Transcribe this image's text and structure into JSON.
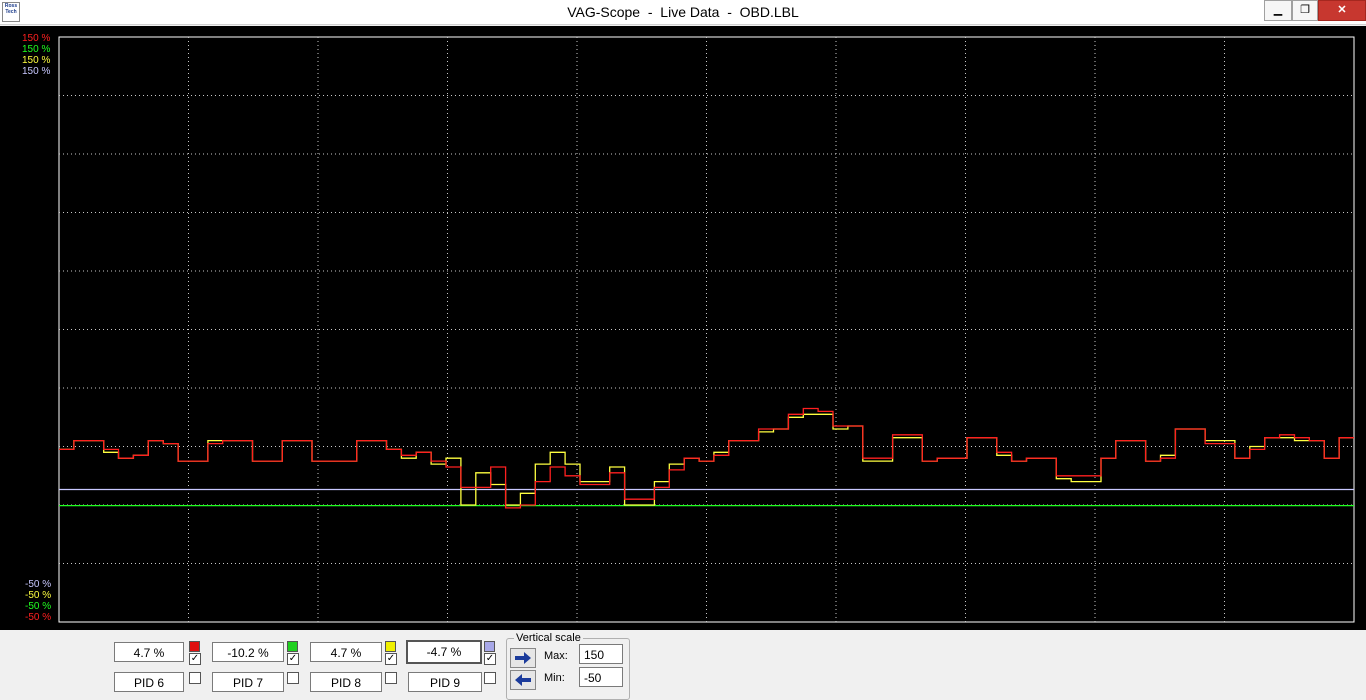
{
  "window": {
    "title": "VAG-Scope  -  Live Data  -  OBD.LBL",
    "icon_text": "Ross Tech",
    "controls": {
      "minimize": "▁",
      "maximize": "❐",
      "close": "✕"
    }
  },
  "scale_labels": {
    "top": [
      {
        "text": "150 %",
        "color": "#ff2020"
      },
      {
        "text": "150 %",
        "color": "#20ff20"
      },
      {
        "text": "150 %",
        "color": "#ffff40"
      },
      {
        "text": "150 %",
        "color": "#c8c8ff"
      }
    ],
    "bottom": [
      {
        "text": "-50 %",
        "color": "#c8c8ff"
      },
      {
        "text": "-50 %",
        "color": "#ffff40"
      },
      {
        "text": "-50 %",
        "color": "#20ff20"
      },
      {
        "text": "-50 %",
        "color": "#ff2020"
      }
    ]
  },
  "chart_data": {
    "type": "line",
    "ylim": [
      -50,
      150
    ],
    "series": [
      {
        "name": "PID 6",
        "color": "#ff2020",
        "values": [
          9,
          12,
          12,
          9,
          6,
          7,
          12,
          11,
          5,
          5,
          11,
          12,
          12,
          5,
          5,
          12,
          12,
          5,
          5,
          5,
          12,
          12,
          9,
          7,
          8,
          5,
          3,
          -4,
          -4,
          3,
          -11,
          -10,
          -2,
          3,
          0,
          -3,
          -3,
          1,
          -8,
          -8,
          -4,
          2,
          6,
          5,
          7,
          12,
          12,
          16,
          16,
          21,
          23,
          22,
          17,
          17,
          6,
          6,
          14,
          14,
          5,
          6,
          6,
          13,
          13,
          8,
          5,
          6,
          6,
          0,
          0,
          0,
          6,
          12,
          12,
          5,
          6,
          16,
          16,
          11,
          11,
          6,
          9,
          13,
          14,
          13,
          12,
          6,
          13,
          13
        ]
      },
      {
        "name": "PID 7",
        "color": "#20ff20",
        "values": [
          -10.2,
          -10.2,
          -10.2,
          -10.2,
          -10.2,
          -10.2,
          -10.2,
          -10.2,
          -10.2,
          -10.2,
          -10.2,
          -10.2,
          -10.2,
          -10.2,
          -10.2,
          -10.2,
          -10.2,
          -10.2,
          -10.2,
          -10.2,
          -10.2,
          -10.2,
          -10.2,
          -10.2,
          -10.2,
          -10.2,
          -10.2,
          -10.2,
          -10.2,
          -10.2,
          -10.2,
          -10.2,
          -10.2,
          -10.2,
          -10.2,
          -10.2,
          -10.2,
          -10.2,
          -10.2,
          -10.2,
          -10.2,
          -10.2,
          -10.2,
          -10.2,
          -10.2,
          -10.2,
          -10.2,
          -10.2,
          -10.2,
          -10.2,
          -10.2,
          -10.2,
          -10.2,
          -10.2,
          -10.2,
          -10.2,
          -10.2,
          -10.2,
          -10.2,
          -10.2,
          -10.2,
          -10.2,
          -10.2,
          -10.2,
          -10.2,
          -10.2,
          -10.2,
          -10.2,
          -10.2,
          -10.2,
          -10.2,
          -10.2,
          -10.2,
          -10.2,
          -10.2,
          -10.2,
          -10.2,
          -10.2,
          -10.2,
          -10.2,
          -10.2,
          -10.2,
          -10.2,
          -10.2,
          -10.2,
          -10.2,
          -10.2,
          -10.2
        ]
      },
      {
        "name": "PID 8",
        "color": "#ffff40",
        "values": [
          9,
          12,
          12,
          8,
          6,
          7,
          12,
          11,
          5,
          5,
          12,
          12,
          12,
          5,
          5,
          12,
          12,
          5,
          5,
          5,
          12,
          12,
          9,
          6,
          8,
          4,
          6,
          -10,
          1,
          -3,
          -10,
          -6,
          4,
          8,
          4,
          -2,
          -2,
          3,
          -10,
          -10,
          -2,
          4,
          6,
          5,
          8,
          12,
          12,
          15,
          16,
          20,
          21,
          21,
          16,
          17,
          5,
          5,
          13,
          13,
          5,
          6,
          6,
          13,
          13,
          7,
          5,
          6,
          6,
          -1,
          -2,
          -2,
          6,
          12,
          12,
          5,
          7,
          16,
          16,
          12,
          12,
          6,
          10,
          13,
          13,
          12,
          12,
          6,
          13,
          13
        ]
      },
      {
        "name": "PID 9",
        "color": "#c8c8ff",
        "values": [
          -4.7,
          -4.7,
          -4.7,
          -4.7,
          -4.7,
          -4.7,
          -4.7,
          -4.7,
          -4.7,
          -4.7,
          -4.7,
          -4.7,
          -4.7,
          -4.7,
          -4.7,
          -4.7,
          -4.7,
          -4.7,
          -4.7,
          -4.7,
          -4.7,
          -4.7,
          -4.7,
          -4.7,
          -4.7,
          -4.7,
          -4.7,
          -4.7,
          -4.7,
          -4.7,
          -4.7,
          -4.7,
          -4.7,
          -4.7,
          -4.7,
          -4.7,
          -4.7,
          -4.7,
          -4.7,
          -4.7,
          -4.7,
          -4.7,
          -4.7,
          -4.7,
          -4.7,
          -4.7,
          -4.7,
          -4.7,
          -4.7,
          -4.7,
          -4.7,
          -4.7,
          -4.7,
          -4.7,
          -4.7,
          -4.7,
          -4.7,
          -4.7,
          -4.7,
          -4.7,
          -4.7,
          -4.7,
          -4.7,
          -4.7,
          -4.7,
          -4.7,
          -4.7,
          -4.7,
          -4.7,
          -4.7,
          -4.7,
          -4.7,
          -4.7,
          -4.7,
          -4.7,
          -4.7,
          -4.7,
          -4.7,
          -4.7,
          -4.7,
          -4.7,
          -4.7,
          -4.7,
          -4.7,
          -4.7,
          -4.7,
          -4.7,
          -4.7
        ]
      }
    ],
    "grid": true
  },
  "channels": [
    {
      "value": "4.7 %",
      "color": "#e01010",
      "checked": true,
      "pid": "PID 6"
    },
    {
      "value": "-10.2 %",
      "color": "#20d020",
      "checked": true,
      "pid": "PID 7"
    },
    {
      "value": "4.7 %",
      "color": "#f0f000",
      "checked": true,
      "pid": "PID 8"
    },
    {
      "value": "-4.7 %",
      "color": "#a8a8e8",
      "checked": true,
      "pid": "PID 9"
    }
  ],
  "vertical_scale": {
    "legend": "Vertical scale",
    "max_label": "Max:",
    "max_value": "150",
    "min_label": "Min:",
    "min_value": "-50"
  }
}
